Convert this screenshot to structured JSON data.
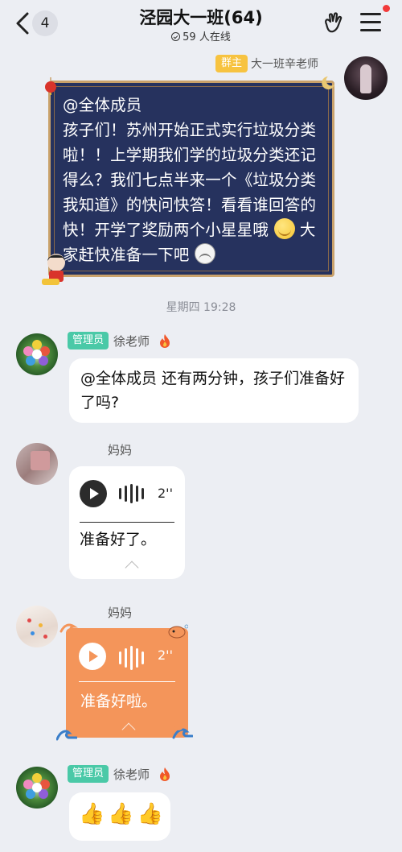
{
  "header": {
    "back_badge": "4",
    "title": "泾园大一班(64)",
    "online_text": "59 人在线"
  },
  "owner_message": {
    "tag": "群主",
    "name": "大一班辛老师",
    "line1": "@全体成员",
    "body_a": "孩子们！苏州开始正式实行垃圾分类啦！！上学期我们学的垃圾分类还记得么？我们七点半来一个《垃圾分类我知道》的快问快答！看看谁回答的快！开学了奖励两个小星星哦",
    "body_b": "大家赶快准备一下吧"
  },
  "timestamp": "星期四 19:28",
  "messages": [
    {
      "tag": "管理员",
      "name": "徐老师",
      "text": "@全体成员 还有两分钟，孩子们准备好了吗?"
    },
    {
      "name": "妈妈",
      "duration": "2''",
      "text": "准备好了。"
    },
    {
      "name": "妈妈",
      "duration": "2''",
      "text": "准备好啦。"
    },
    {
      "tag": "管理员",
      "name": "徐老师",
      "text": "👍👍👍"
    }
  ],
  "colors": {
    "background": "#eceef3",
    "owner_tag": "#f7c340",
    "admin_tag": "#4ac9a7",
    "owner_card": "#26325e",
    "orange_bubble": "#f4955a"
  },
  "icons": [
    "back-chevron-icon",
    "gesture-icon",
    "menu-icon",
    "fire-icon",
    "play-icon",
    "waveform-icon"
  ]
}
